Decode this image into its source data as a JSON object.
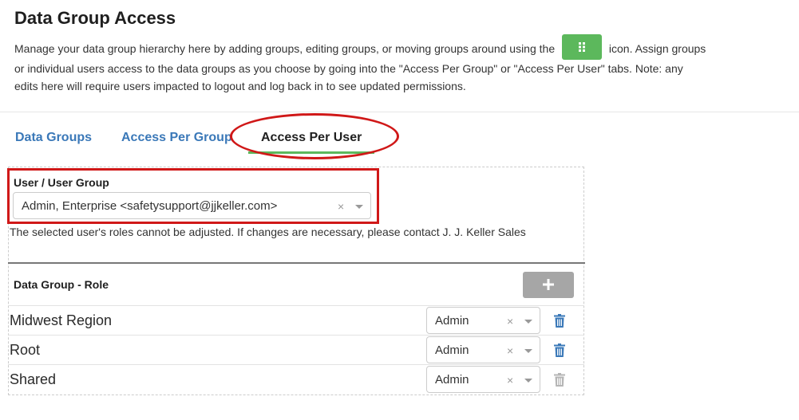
{
  "page": {
    "title": "Data Group Access",
    "description_part1": "Manage your data group hierarchy here by adding groups, editing groups, or moving groups around using the",
    "description_part2": "icon. Assign groups",
    "description_line2": "or individual users access to the data groups as you choose by going into the \"Access Per Group\" or \"Access Per User\" tabs. Note: any",
    "description_line3": "edits here will require users impacted to logout and log back in to see updated permissions."
  },
  "tabs": [
    {
      "label": "Data Groups"
    },
    {
      "label": "Access Per Group"
    },
    {
      "label": "Access Per User"
    }
  ],
  "active_tab": "Access Per User",
  "user_field": {
    "label": "User / User Group",
    "value": "Admin, Enterprise <safetysupport@jjkeller.com>",
    "clear_symbol": "×"
  },
  "notice": "The selected user's roles cannot be adjusted. If changes are necessary, please contact J. J. Keller Sales",
  "table": {
    "header": "Data Group - Role",
    "add_label": "+",
    "rows": [
      {
        "name": "Midwest Region",
        "role": "Admin",
        "delete_enabled": true
      },
      {
        "name": "Root",
        "role": "Admin",
        "delete_enabled": true
      },
      {
        "name": "Shared",
        "role": "Admin",
        "delete_enabled": false
      }
    ]
  },
  "colors": {
    "accent_green": "#5cb85c",
    "link_blue": "#3a78b8",
    "highlight_red": "#d01818",
    "trash_enabled": "#3a78b8",
    "trash_disabled": "#b5b5b5"
  },
  "icons": {
    "grip": "grip-icon",
    "add": "plus-icon",
    "delete": "trash-icon",
    "clear": "close-icon",
    "dropdown": "chevron-down-icon"
  }
}
